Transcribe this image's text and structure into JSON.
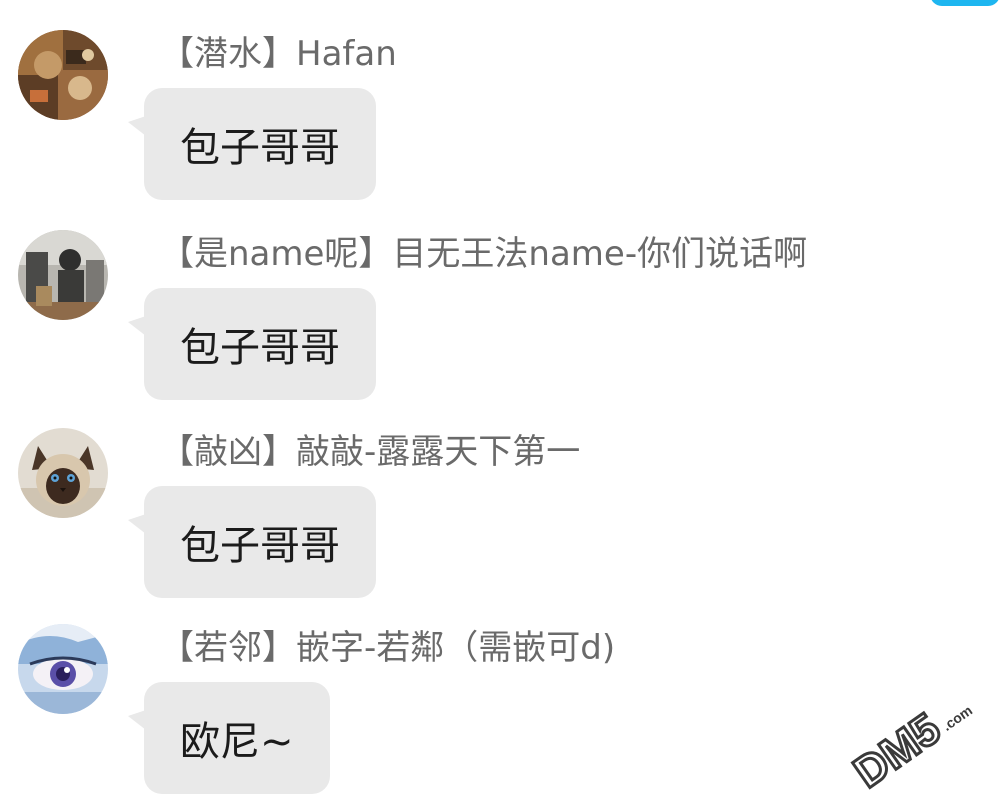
{
  "messages": [
    {
      "sender": "【潜水】Hafan",
      "text": "包子哥哥",
      "avatar_icon": "avatar-scrapbook-icon"
    },
    {
      "sender": "【是name呢】目无王法name-你们说话啊",
      "text": "包子哥哥",
      "avatar_icon": "avatar-photo-icon"
    },
    {
      "sender": "【敲凶】敲敲-露露天下第一",
      "text": "包子哥哥",
      "avatar_icon": "avatar-siamese-cat-icon"
    },
    {
      "sender": "【若邻】嵌字-若鄰（需嵌可d)",
      "text": "欧尼~",
      "avatar_icon": "avatar-anime-eye-icon"
    }
  ],
  "watermark": {
    "text": "DM5",
    "suffix": ".com"
  },
  "colors": {
    "bubble": "#e9e9e9",
    "sender_text": "#6a6a6a",
    "message_text": "#1b1b1b",
    "accent": "#1eb6f0"
  }
}
